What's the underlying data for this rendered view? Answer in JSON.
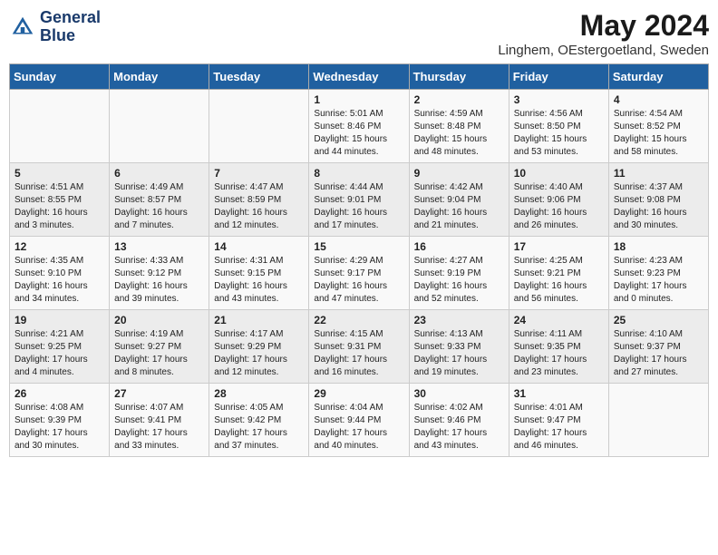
{
  "header": {
    "logo_line1": "General",
    "logo_line2": "Blue",
    "month": "May 2024",
    "location": "Linghem, OEstergoetland, Sweden"
  },
  "days_of_week": [
    "Sunday",
    "Monday",
    "Tuesday",
    "Wednesday",
    "Thursday",
    "Friday",
    "Saturday"
  ],
  "weeks": [
    [
      {
        "day": "",
        "info": ""
      },
      {
        "day": "",
        "info": ""
      },
      {
        "day": "",
        "info": ""
      },
      {
        "day": "1",
        "info": "Sunrise: 5:01 AM\nSunset: 8:46 PM\nDaylight: 15 hours\nand 44 minutes."
      },
      {
        "day": "2",
        "info": "Sunrise: 4:59 AM\nSunset: 8:48 PM\nDaylight: 15 hours\nand 48 minutes."
      },
      {
        "day": "3",
        "info": "Sunrise: 4:56 AM\nSunset: 8:50 PM\nDaylight: 15 hours\nand 53 minutes."
      },
      {
        "day": "4",
        "info": "Sunrise: 4:54 AM\nSunset: 8:52 PM\nDaylight: 15 hours\nand 58 minutes."
      }
    ],
    [
      {
        "day": "5",
        "info": "Sunrise: 4:51 AM\nSunset: 8:55 PM\nDaylight: 16 hours\nand 3 minutes."
      },
      {
        "day": "6",
        "info": "Sunrise: 4:49 AM\nSunset: 8:57 PM\nDaylight: 16 hours\nand 7 minutes."
      },
      {
        "day": "7",
        "info": "Sunrise: 4:47 AM\nSunset: 8:59 PM\nDaylight: 16 hours\nand 12 minutes."
      },
      {
        "day": "8",
        "info": "Sunrise: 4:44 AM\nSunset: 9:01 PM\nDaylight: 16 hours\nand 17 minutes."
      },
      {
        "day": "9",
        "info": "Sunrise: 4:42 AM\nSunset: 9:04 PM\nDaylight: 16 hours\nand 21 minutes."
      },
      {
        "day": "10",
        "info": "Sunrise: 4:40 AM\nSunset: 9:06 PM\nDaylight: 16 hours\nand 26 minutes."
      },
      {
        "day": "11",
        "info": "Sunrise: 4:37 AM\nSunset: 9:08 PM\nDaylight: 16 hours\nand 30 minutes."
      }
    ],
    [
      {
        "day": "12",
        "info": "Sunrise: 4:35 AM\nSunset: 9:10 PM\nDaylight: 16 hours\nand 34 minutes."
      },
      {
        "day": "13",
        "info": "Sunrise: 4:33 AM\nSunset: 9:12 PM\nDaylight: 16 hours\nand 39 minutes."
      },
      {
        "day": "14",
        "info": "Sunrise: 4:31 AM\nSunset: 9:15 PM\nDaylight: 16 hours\nand 43 minutes."
      },
      {
        "day": "15",
        "info": "Sunrise: 4:29 AM\nSunset: 9:17 PM\nDaylight: 16 hours\nand 47 minutes."
      },
      {
        "day": "16",
        "info": "Sunrise: 4:27 AM\nSunset: 9:19 PM\nDaylight: 16 hours\nand 52 minutes."
      },
      {
        "day": "17",
        "info": "Sunrise: 4:25 AM\nSunset: 9:21 PM\nDaylight: 16 hours\nand 56 minutes."
      },
      {
        "day": "18",
        "info": "Sunrise: 4:23 AM\nSunset: 9:23 PM\nDaylight: 17 hours\nand 0 minutes."
      }
    ],
    [
      {
        "day": "19",
        "info": "Sunrise: 4:21 AM\nSunset: 9:25 PM\nDaylight: 17 hours\nand 4 minutes."
      },
      {
        "day": "20",
        "info": "Sunrise: 4:19 AM\nSunset: 9:27 PM\nDaylight: 17 hours\nand 8 minutes."
      },
      {
        "day": "21",
        "info": "Sunrise: 4:17 AM\nSunset: 9:29 PM\nDaylight: 17 hours\nand 12 minutes."
      },
      {
        "day": "22",
        "info": "Sunrise: 4:15 AM\nSunset: 9:31 PM\nDaylight: 17 hours\nand 16 minutes."
      },
      {
        "day": "23",
        "info": "Sunrise: 4:13 AM\nSunset: 9:33 PM\nDaylight: 17 hours\nand 19 minutes."
      },
      {
        "day": "24",
        "info": "Sunrise: 4:11 AM\nSunset: 9:35 PM\nDaylight: 17 hours\nand 23 minutes."
      },
      {
        "day": "25",
        "info": "Sunrise: 4:10 AM\nSunset: 9:37 PM\nDaylight: 17 hours\nand 27 minutes."
      }
    ],
    [
      {
        "day": "26",
        "info": "Sunrise: 4:08 AM\nSunset: 9:39 PM\nDaylight: 17 hours\nand 30 minutes."
      },
      {
        "day": "27",
        "info": "Sunrise: 4:07 AM\nSunset: 9:41 PM\nDaylight: 17 hours\nand 33 minutes."
      },
      {
        "day": "28",
        "info": "Sunrise: 4:05 AM\nSunset: 9:42 PM\nDaylight: 17 hours\nand 37 minutes."
      },
      {
        "day": "29",
        "info": "Sunrise: 4:04 AM\nSunset: 9:44 PM\nDaylight: 17 hours\nand 40 minutes."
      },
      {
        "day": "30",
        "info": "Sunrise: 4:02 AM\nSunset: 9:46 PM\nDaylight: 17 hours\nand 43 minutes."
      },
      {
        "day": "31",
        "info": "Sunrise: 4:01 AM\nSunset: 9:47 PM\nDaylight: 17 hours\nand 46 minutes."
      },
      {
        "day": "",
        "info": ""
      }
    ]
  ]
}
